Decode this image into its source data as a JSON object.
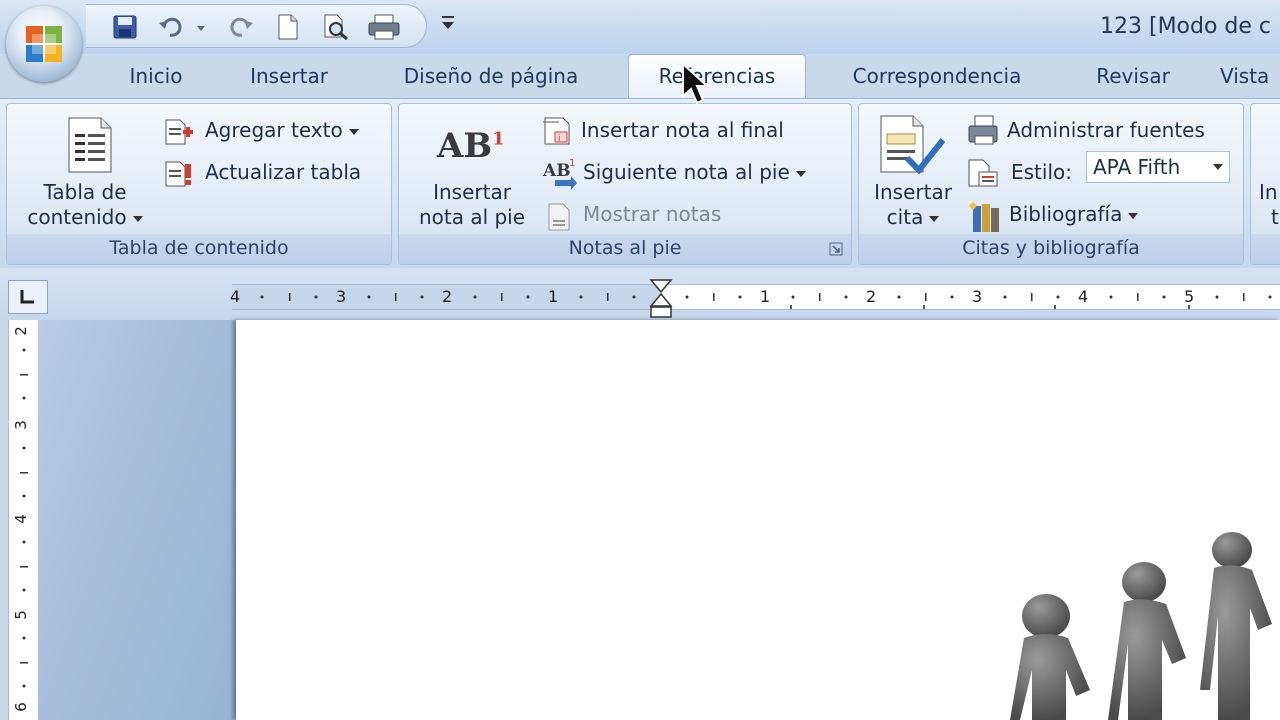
{
  "window": {
    "title": "123 [Modo de c"
  },
  "quick_access": {
    "icons": [
      "save-icon",
      "undo-icon",
      "redo-icon",
      "new-document-icon",
      "print-preview-icon",
      "print-icon",
      "customize-dropdown-icon"
    ]
  },
  "tabs": [
    {
      "label": "Inicio"
    },
    {
      "label": "Insertar"
    },
    {
      "label": "Diseño de página"
    },
    {
      "label": "Referencias",
      "active": true
    },
    {
      "label": "Correspondencia"
    },
    {
      "label": "Revisar"
    },
    {
      "label": "Vista"
    }
  ],
  "ribbon": {
    "toc": {
      "label": "Tabla de contenido",
      "big_button_line1": "Tabla de",
      "big_button_line2": "contenido",
      "add_text": "Agregar texto",
      "update_table": "Actualizar tabla"
    },
    "footnotes": {
      "label": "Notas al pie",
      "insert_footnote_line1": "Insertar",
      "insert_footnote_line2": "nota al pie",
      "insert_endnote": "Insertar nota al final",
      "next_footnote": "Siguiente nota al pie",
      "show_notes": "Mostrar notas",
      "icon_text": "AB",
      "icon_superscript": "1"
    },
    "citations": {
      "label": "Citas y bibliografía",
      "insert_citation_line1": "Insertar",
      "insert_citation_line2": "cita",
      "manage_sources": "Administrar fuentes",
      "style_label": "Estilo:",
      "style_value": "APA Fifth",
      "bibliography": "Bibliografía"
    },
    "partial": {
      "line1": "In",
      "line2": "t"
    }
  },
  "ruler": {
    "horizontal_numbers": [
      "4",
      "3",
      "2",
      "1",
      "1",
      "2",
      "3",
      "4",
      "5"
    ],
    "vertical_numbers": [
      "2",
      "3",
      "4",
      "5",
      "6"
    ]
  },
  "colors": {
    "ribbon_bg": "#d5e3f4",
    "tab_text": "#1f3a60",
    "accent": "#4a78b5"
  }
}
